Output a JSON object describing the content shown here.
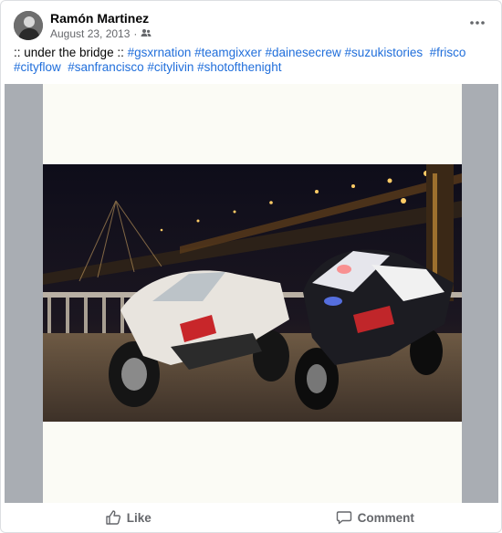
{
  "post": {
    "author": "Ramón Martinez",
    "date": "August 23, 2013",
    "audience_icon": "friends-icon",
    "caption_prefix": ":: under the bridge :: ",
    "hashtags": [
      "#gsxrnation",
      "#teamgixxer",
      "#dainesecrew",
      "#suzukistories",
      "#frisco",
      "#cityflow",
      "#sanfrancisco",
      "#citylivin",
      "#shotofthenight"
    ]
  },
  "actions": {
    "like_label": "Like",
    "comment_label": "Comment"
  },
  "colors": {
    "link": "#216fdb",
    "muted": "#65676b",
    "media_bg": "#a9adb3"
  }
}
